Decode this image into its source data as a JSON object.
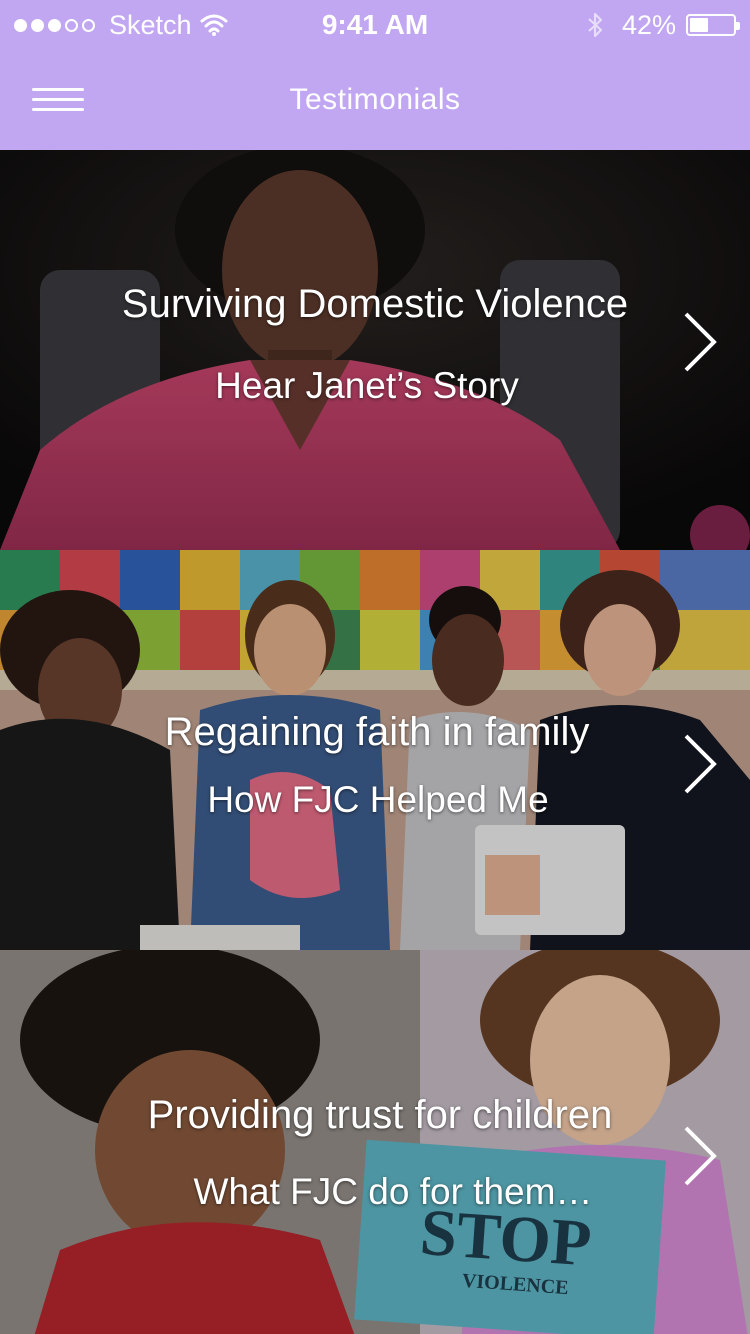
{
  "status_bar": {
    "carrier": "Sketch",
    "time": "9:41 AM",
    "battery": "42%",
    "battery_level": 0.42,
    "signal_bars_filled": 3,
    "signal_bars_total": 5,
    "icons": [
      "wifi-icon",
      "bluetooth-icon",
      "battery-icon"
    ]
  },
  "nav": {
    "title": "Testimonials",
    "menu_icon": "hamburger-menu-icon"
  },
  "colors": {
    "accent": "#c1a6f2",
    "text": "#ffffff"
  },
  "cards": [
    {
      "title": "Surviving Domestic Violence",
      "subtitle": "Hear Janet’s Story"
    },
    {
      "title": "Regaining  faith in family",
      "subtitle": "How FJC Helped Me"
    },
    {
      "title": "Providing trust for children",
      "subtitle": "What FJC do for them…"
    }
  ]
}
